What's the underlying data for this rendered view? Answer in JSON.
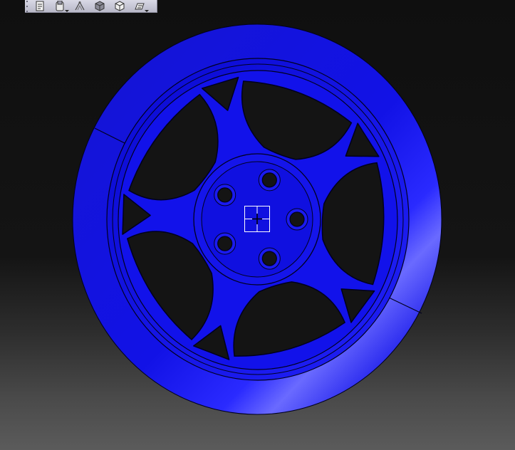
{
  "toolbar": {
    "buttons": [
      {
        "icon": "new-sketch-icon",
        "has_dropdown": false
      },
      {
        "icon": "part-body-icon",
        "has_dropdown": true
      },
      {
        "icon": "sketch-tools-icon",
        "has_dropdown": false
      },
      {
        "icon": "solid-view-icon",
        "has_dropdown": false
      },
      {
        "icon": "wireframe-view-icon",
        "has_dropdown": false
      },
      {
        "icon": "drawing-pad-icon",
        "has_dropdown": true
      }
    ]
  },
  "viewport": {
    "background_top": "#0f0f0f",
    "background_bottom": "#5b5b5b",
    "part_color": "#1010e6",
    "edge_color": "#00001e",
    "highlight_color": "#6a6aff",
    "hub_bolt_holes": 5,
    "spoke_windows": 5,
    "pocket_triangles": 5
  },
  "compass": {
    "icon": "axis-origin-icon",
    "color": "#ffffff"
  }
}
